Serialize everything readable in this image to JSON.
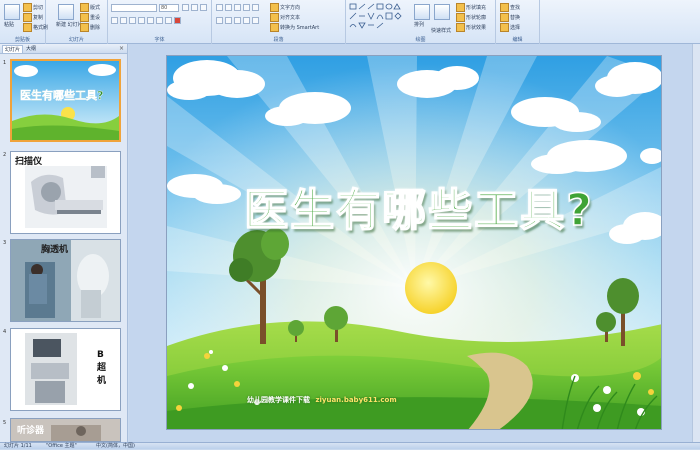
{
  "ribbon": {
    "clipboard": {
      "paste": "粘贴",
      "cut": "剪切",
      "copy": "复制",
      "format_painter": "格式刷",
      "label": "剪贴板"
    },
    "slides": {
      "new_slide": "新建\n幻灯片",
      "layout": "版式",
      "reset": "重设",
      "delete": "删除",
      "label": "幻灯片"
    },
    "font": {
      "font_name": "",
      "font_size": "80",
      "label": "字体"
    },
    "paragraph": {
      "text_direction": "文字方向",
      "align_text": "对齐文本",
      "smartart": "转换为 SmartArt",
      "label": "段落"
    },
    "drawing": {
      "arrange": "排列",
      "quick_styles": "快速样式",
      "shape_fill": "形状填充",
      "shape_outline": "形状轮廓",
      "shape_effects": "形状效果",
      "label": "绘图"
    },
    "editing": {
      "find": "查找",
      "replace": "替换",
      "select": "选择",
      "label": "编辑"
    }
  },
  "panel": {
    "tab_slides": "幻灯片",
    "tab_outline": "大纲",
    "close": "×",
    "thumbs": [
      {
        "num": "1",
        "text": "医生有哪些工具?"
      },
      {
        "num": "2",
        "text": "扫描仪"
      },
      {
        "num": "3",
        "text": "胸透机"
      },
      {
        "num": "4",
        "text": "B超机"
      },
      {
        "num": "5",
        "text": "听诊器"
      }
    ]
  },
  "slide": {
    "title": "医生有哪些工具?",
    "footer_left": "幼儿园教学课件下载",
    "footer_url": "ziyuan.baby611.com"
  },
  "status": {
    "slide_index": "幻灯片 1/11",
    "theme": "\"Office 主题\"",
    "language": "中文(简体，中国)"
  },
  "colors": {
    "sky_top": "#3aa7e6",
    "grass": "#7cc83a",
    "title_green": "#3fa335",
    "accent_orange": "#f0a33a"
  }
}
